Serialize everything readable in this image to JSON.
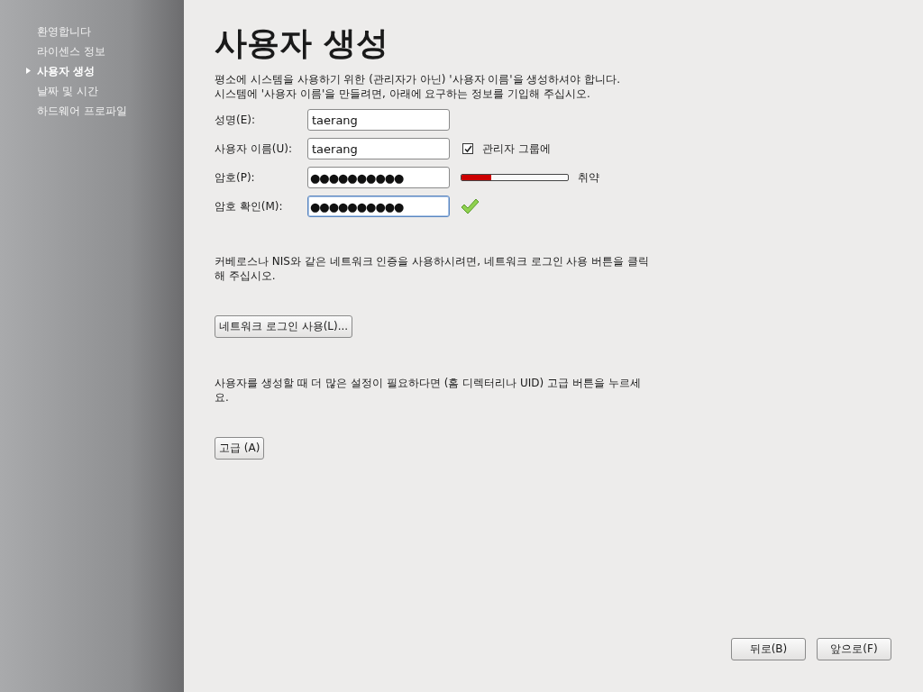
{
  "sidebar": {
    "items": [
      {
        "label": "환영합니다",
        "selected": false
      },
      {
        "label": "라이센스 정보",
        "selected": false
      },
      {
        "label": "사용자 생성",
        "selected": true
      },
      {
        "label": "날짜 및 시간",
        "selected": false
      },
      {
        "label": "하드웨어 프로파일",
        "selected": false
      }
    ]
  },
  "title": "사용자 생성",
  "intro": [
    "평소에 시스템을 사용하기 위한 (관리자가 아닌) '사용자 이름'을 생성하셔야 합니다.",
    "시스템에 '사용자 이름'을 만들려면, 아래에 요구하는 정보를 기입해 주십시오."
  ],
  "fields": [
    {
      "kind": "plain",
      "label": "성명(E):",
      "value": "taerang",
      "focused": false
    },
    {
      "kind": "checkbox",
      "label": "사용자 이름(U):",
      "value": "taerang",
      "focused": false,
      "checkbox": {
        "label": "관리자 그룹에",
        "checked": true
      }
    },
    {
      "kind": "strength",
      "label": "암호(P):",
      "value": "●●●●●●●●●●",
      "focused": false,
      "strength": {
        "level": 0.28,
        "label": "취약"
      }
    },
    {
      "kind": "match",
      "label": "암호 확인(M):",
      "value": "●●●●●●●●●●",
      "focused": true
    }
  ],
  "network_text": "커베로스나 NIS와 같은 네트워크 인증을 사용하시려면, 네트워크 로그인 사용 버튼을 클릭해 주십시오.",
  "network_button": "네트워크 로그인 사용(L)...",
  "advanced_text": "사용자를 생성할 때 더 많은 설정이 필요하다면 (홈 디렉터리나 UID) 고급 버튼을 누르세요.",
  "advanced_button": "고급 (A)",
  "footer": {
    "back": "뒤로(B)",
    "forward": "앞으로(F)"
  }
}
